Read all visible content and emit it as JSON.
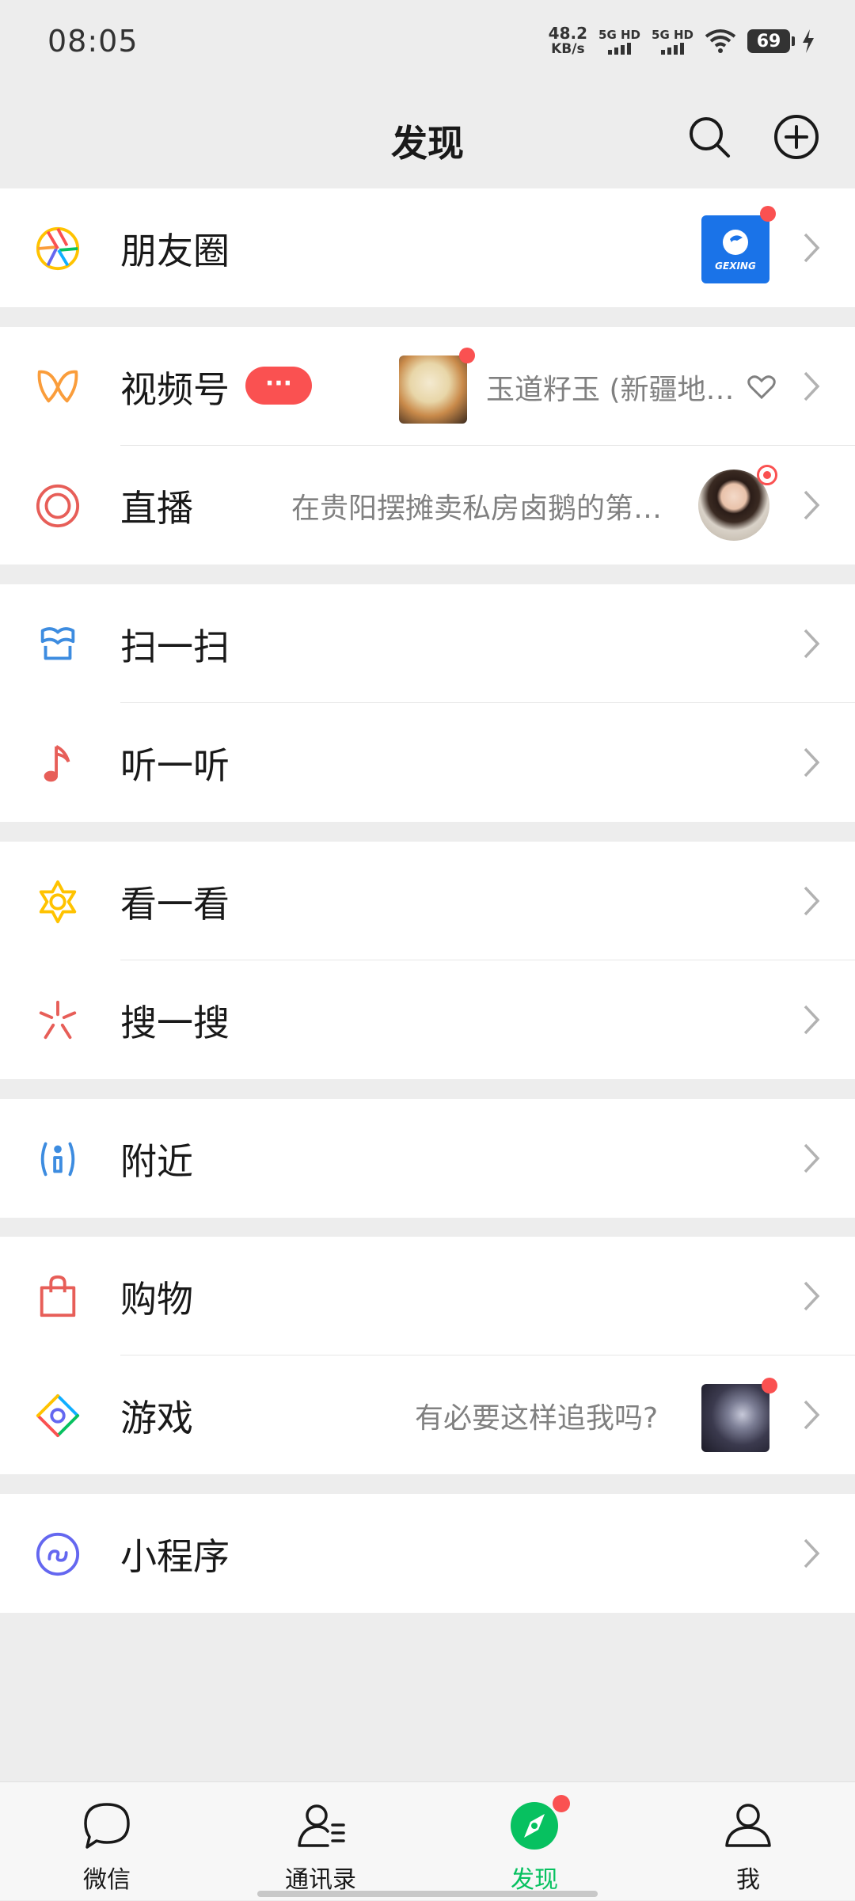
{
  "status": {
    "time": "08:05",
    "speed_value": "48.2",
    "speed_unit": "KB/s",
    "sim1": "5G HD",
    "sim2": "5G HD",
    "battery": "69"
  },
  "header": {
    "title": "发现",
    "search_icon": "search-icon",
    "add_icon": "plus-circle-icon"
  },
  "moments": {
    "label": "朋友圈",
    "thumb_text": "GEXING",
    "accent": "#1A73E8"
  },
  "channels": {
    "label": "视频号",
    "badge": "···",
    "subtitle": "玉道籽玉 (新疆地…"
  },
  "live": {
    "label": "直播",
    "subtitle": "在贵阳摆摊卖私房卤鹅的第…"
  },
  "scan": {
    "label": "扫一扫"
  },
  "listen": {
    "label": "听一听"
  },
  "look": {
    "label": "看一看"
  },
  "search": {
    "label": "搜一搜"
  },
  "nearby": {
    "label": "附近"
  },
  "shopping": {
    "label": "购物"
  },
  "games": {
    "label": "游戏",
    "subtitle": "有必要这样追我吗?"
  },
  "miniprogram": {
    "label": "小程序"
  },
  "nav": {
    "items": [
      {
        "label": "微信",
        "icon": "chat-bubble-icon",
        "active": false
      },
      {
        "label": "通讯录",
        "icon": "contacts-icon",
        "active": false
      },
      {
        "label": "发现",
        "icon": "compass-icon",
        "active": true
      },
      {
        "label": "我",
        "icon": "person-icon",
        "active": false
      }
    ]
  },
  "colors": {
    "accent_green": "#07C160",
    "badge_red": "#FA5151",
    "background": "#EDEDED"
  }
}
